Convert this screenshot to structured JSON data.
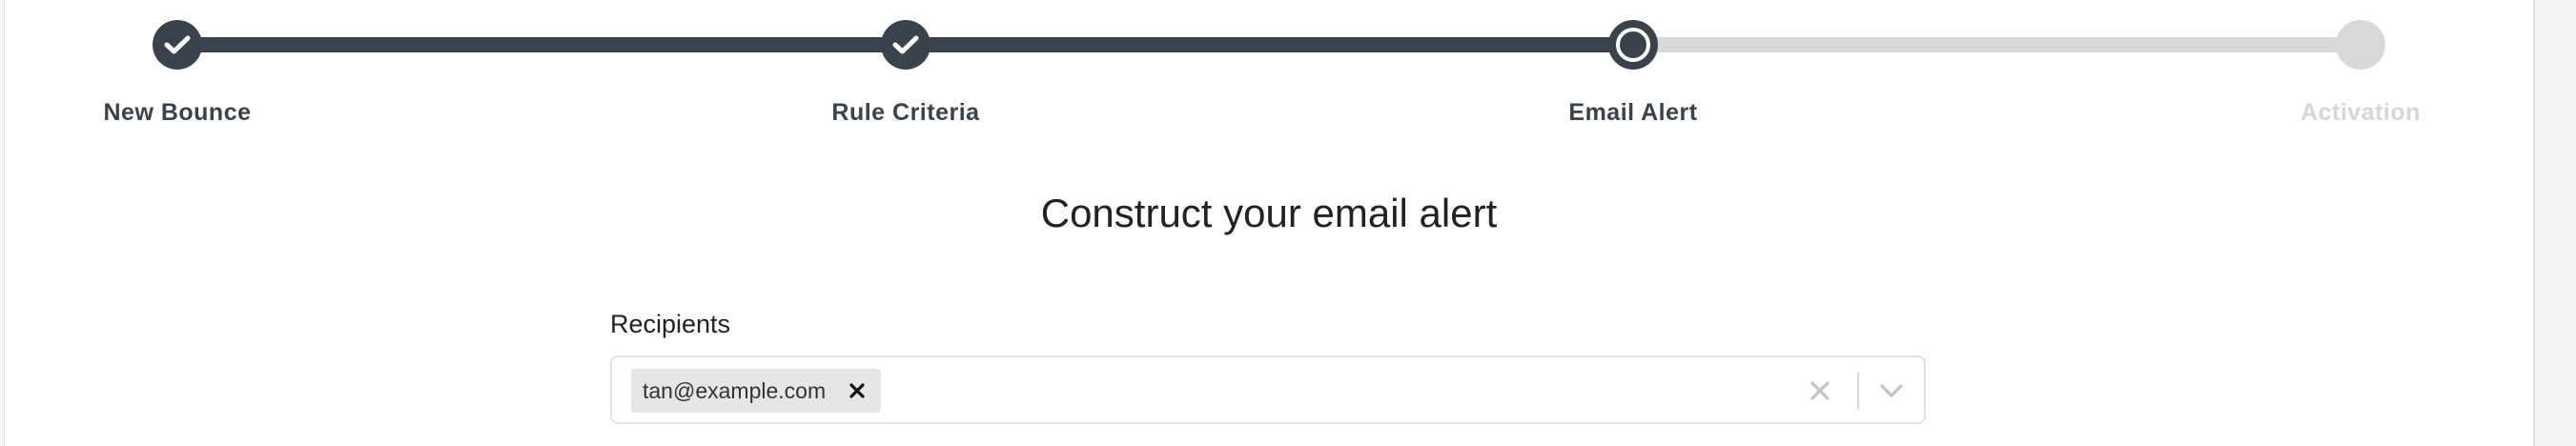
{
  "stepper": {
    "steps": [
      {
        "label": "New Bounce",
        "state": "done"
      },
      {
        "label": "Rule Criteria",
        "state": "done"
      },
      {
        "label": "Email Alert",
        "state": "current"
      },
      {
        "label": "Activation",
        "state": "todo"
      }
    ]
  },
  "form": {
    "heading": "Construct your email alert",
    "recipients_label": "Recipients",
    "recipients": [
      {
        "email": "tan@example.com"
      }
    ]
  },
  "icons": {
    "done_step": "check-icon",
    "chip_remove": "close-icon",
    "clear": "clear-icon",
    "dropdown": "chevron-down-icon"
  },
  "colors": {
    "active": "#3a434c",
    "inactive": "#d8d8d8"
  }
}
